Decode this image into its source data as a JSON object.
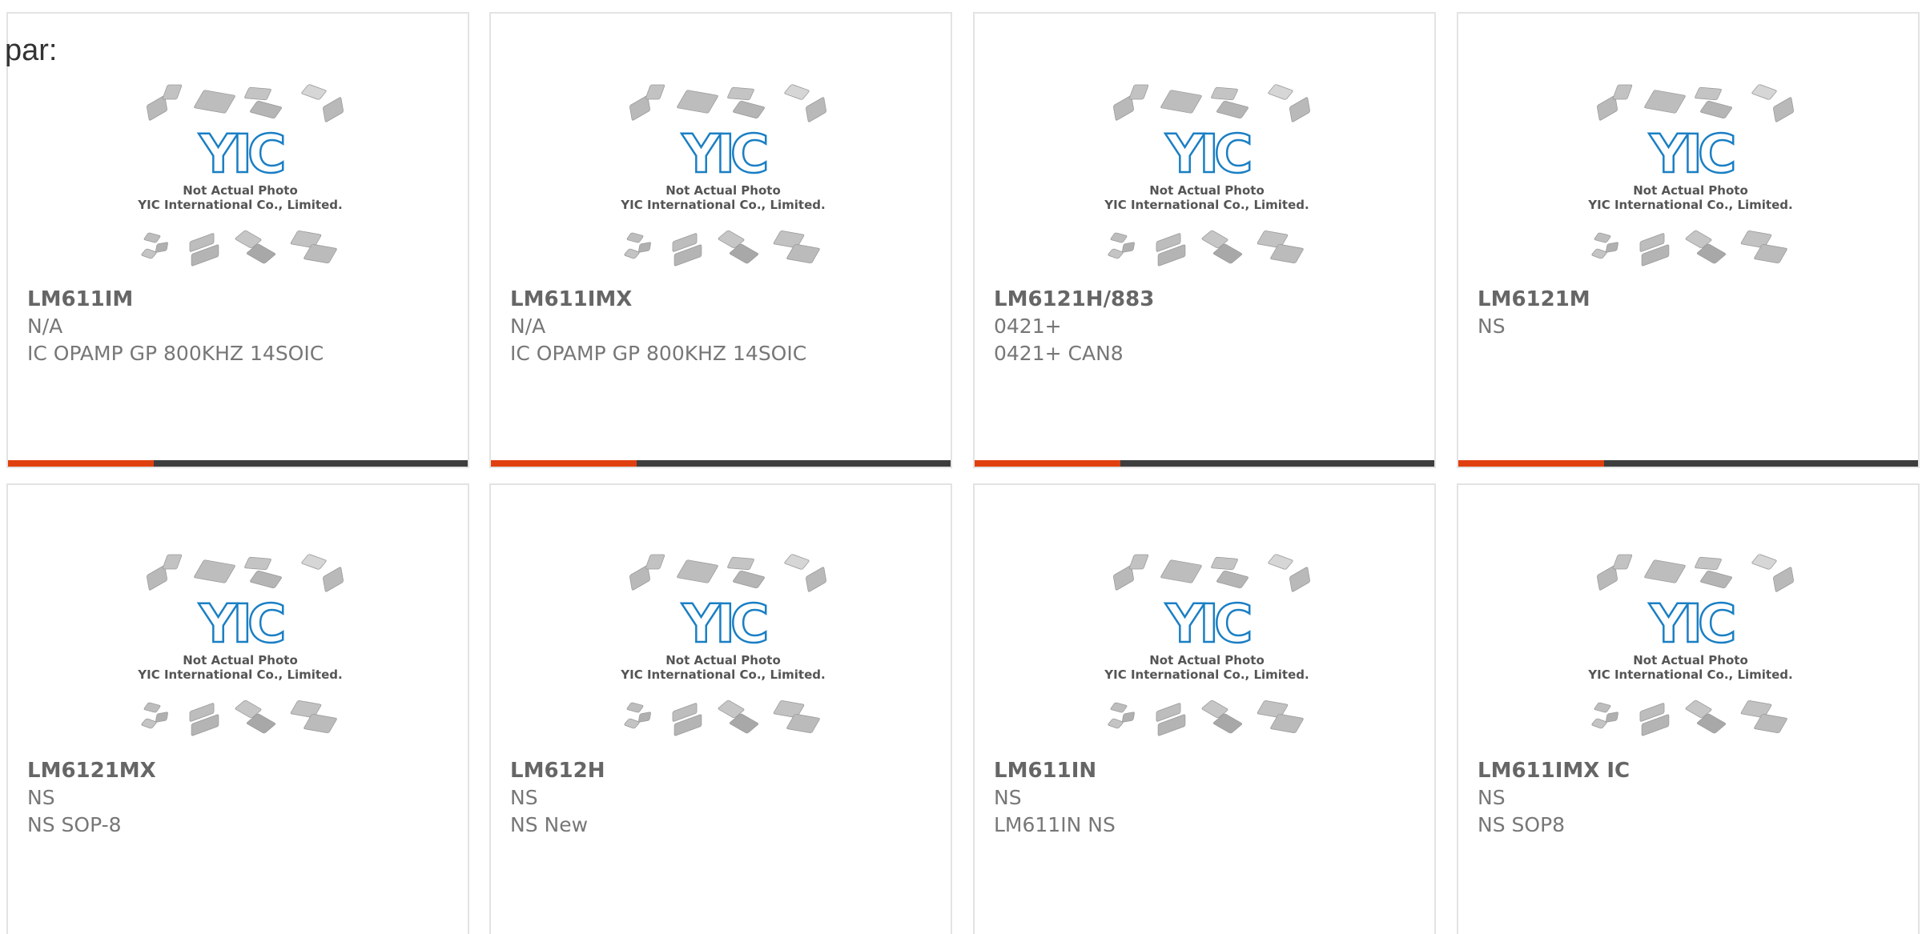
{
  "prefix": "par:",
  "thumbnail": {
    "caption_line1": "Not Actual Photo",
    "caption_line2": "YIC International Co., Limited.",
    "logo_text": "YIC",
    "logo_color": "#1a7fc4"
  },
  "colors": {
    "accent_bar": "#e0400f",
    "dark_bar": "#3d3d3d",
    "card_border": "#e3e3e3"
  },
  "products": [
    {
      "part_number": "LM611IM",
      "manufacturer": "N/A",
      "description": "IC OPAMP GP 800KHZ 14SOIC"
    },
    {
      "part_number": "LM611IMX",
      "manufacturer": "N/A",
      "description": "IC OPAMP GP 800KHZ 14SOIC"
    },
    {
      "part_number": "LM6121H/883",
      "manufacturer": "0421+",
      "description": "0421+ CAN8"
    },
    {
      "part_number": "LM6121M",
      "manufacturer": "NS",
      "description": ""
    },
    {
      "part_number": "LM6121MX",
      "manufacturer": "NS",
      "description": "NS SOP-8"
    },
    {
      "part_number": "LM612H",
      "manufacturer": "NS",
      "description": "NS New"
    },
    {
      "part_number": "LM611IN",
      "manufacturer": "NS",
      "description": "LM611IN NS"
    },
    {
      "part_number": "LM611IMX IC",
      "manufacturer": "NS",
      "description": "NS SOP8"
    }
  ]
}
